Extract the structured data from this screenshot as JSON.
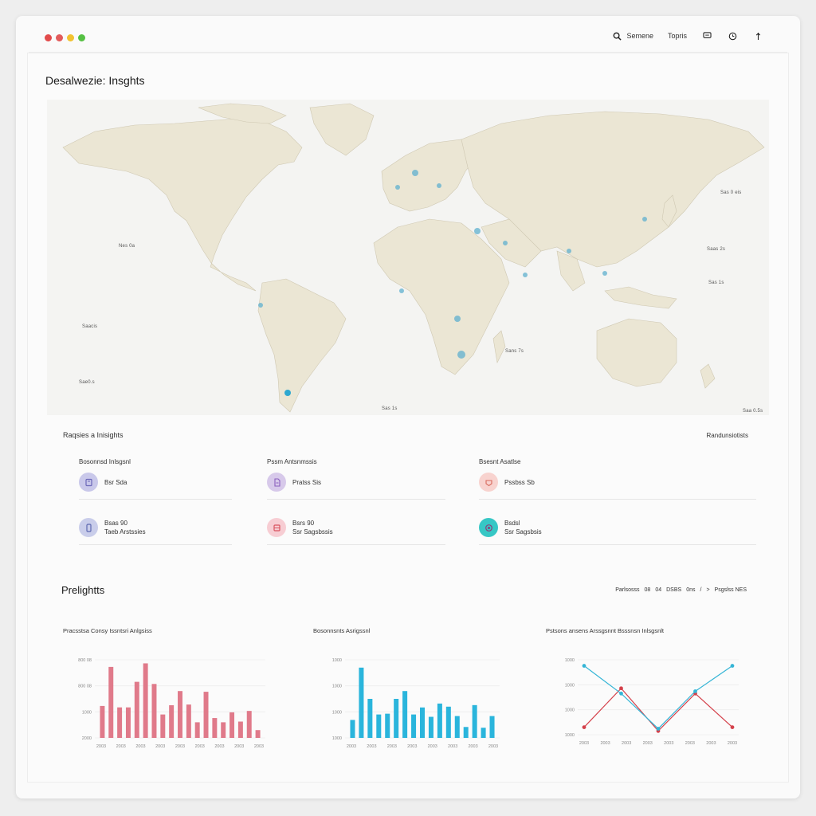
{
  "window": {
    "controls": [
      {
        "name": "close",
        "color": "#e24b4b"
      },
      {
        "name": "minimize",
        "color": "#e25b5b"
      },
      {
        "name": "zoom",
        "color": "#f2c230"
      },
      {
        "name": "extra",
        "color": "#55c043"
      }
    ]
  },
  "toolbar": {
    "search_label": "Semene",
    "topic_label": "Topris",
    "chat_icon": "chat-icon",
    "clock_icon": "clock-icon",
    "menu_icon": "more-icon"
  },
  "page": {
    "title": "Desalwezie: Insghts"
  },
  "map": {
    "labels": [
      "Nes 0a",
      "Saacis",
      "Sae0.s",
      "Sas 0 eis",
      "Saas 2s",
      "Sas 1s",
      "Sans 7s",
      "Sas 1s",
      "Saa 0.5s"
    ],
    "marker_color": "#3fa9c9"
  },
  "regional": {
    "title": "Raqsies a Inisights",
    "right_label": "Randunsiotists",
    "cards": [
      {
        "heading": "Bosonnsd Inlsgsnl",
        "items": [
          {
            "icon": "document-icon",
            "icon_bg": "#c9c8ea",
            "icon_color": "#6b67b8",
            "lines": [
              "Bsr Sda"
            ]
          },
          {
            "icon": "phone-icon",
            "icon_bg": "#c9cdea",
            "icon_color": "#5c67b0",
            "lines": [
              "Bsas 90",
              "Taeb Arstssies"
            ]
          }
        ]
      },
      {
        "heading": "Pssm Antsnmssis",
        "items": [
          {
            "icon": "file-icon",
            "icon_bg": "#d7c9ea",
            "icon_color": "#8a5fbd",
            "lines": [
              "Pratss Sis"
            ]
          },
          {
            "icon": "storage-icon",
            "icon_bg": "#f7cdd3",
            "icon_color": "#d9535f",
            "lines": [
              "Bsrs 90",
              "Ssr Sagsbssis"
            ]
          }
        ]
      },
      {
        "heading": "Bsesnt Asatlse",
        "items": [
          {
            "icon": "tag-icon",
            "icon_bg": "#f8d3cf",
            "icon_color": "#d76a5d",
            "lines": [
              "Pssbss Sb"
            ]
          },
          {
            "icon": "target-icon",
            "icon_bg": "#37c7c5",
            "icon_color": "#8a3f7a",
            "lines": [
              "Bsdsl",
              "Ssr Sagsbsis"
            ]
          }
        ]
      }
    ]
  },
  "predictions": {
    "title": "Prelightts",
    "pager": [
      "Parlsosss",
      "08",
      "04",
      "DSBS",
      "0ns",
      "/",
      ">",
      "Psgslss NES"
    ],
    "charts": [
      {
        "title": "Pracsstsa Consy Issntsri Anlgsiss",
        "color": "#e07a8a",
        "y_ticks": [
          "800 08",
          "800 08",
          "1000",
          "2000"
        ],
        "x_ticks": [
          "2003",
          "2003",
          "2003",
          "2003",
          "2003",
          "2003",
          "2003",
          "2003",
          "2003"
        ]
      },
      {
        "title": "Bosonnsnts Asrigssnl",
        "color": "#2ab5dc",
        "y_ticks": [
          "1000",
          "1000",
          "1000",
          "1000"
        ],
        "x_ticks": [
          "2003",
          "2003",
          "2003",
          "2003",
          "2003",
          "2003",
          "2003",
          "2003"
        ]
      },
      {
        "title": "Pstsons ansens Arssgsnnt Bsssnsn Inlsgsnlt",
        "color_a": "#d4404a",
        "color_b": "#35b5d6",
        "y_ticks": [
          "1000",
          "1000",
          "1000",
          "1000"
        ],
        "x_ticks": [
          "2003",
          "2003",
          "2003",
          "2003",
          "2003",
          "2003",
          "2003",
          "2003"
        ]
      }
    ]
  },
  "chart_data": [
    {
      "type": "bar",
      "title": "Pracsstsa Consy Issntsri Anlgsiss",
      "categories": [
        "2003",
        "2003",
        "2003",
        "2003",
        "2003",
        "2003",
        "2003",
        "2003",
        "2003"
      ],
      "values": [
        45,
        100,
        43,
        43,
        79,
        105,
        76,
        33,
        46,
        66,
        47,
        22,
        65,
        28,
        22,
        36,
        23,
        38,
        11
      ],
      "ylim": [
        0,
        110
      ]
    },
    {
      "type": "bar",
      "title": "Bosonnsnts Asrigssnl",
      "categories": [
        "2003",
        "2003",
        "2003",
        "2003",
        "2003",
        "2003",
        "2003",
        "2003"
      ],
      "values": [
        23,
        90,
        50,
        30,
        31,
        50,
        60,
        30,
        39,
        27,
        44,
        40,
        28,
        14,
        42,
        13,
        28
      ],
      "ylim": [
        0,
        100
      ]
    },
    {
      "type": "line",
      "title": "Pstsons ansens Arssgsnnt Bsssnsn Inlsgsnlt",
      "series": [
        {
          "values": [
            10,
            62,
            5,
            55,
            10
          ]
        },
        {
          "values": [
            92,
            55,
            8,
            58,
            92
          ]
        }
      ],
      "ylim": [
        0,
        100
      ]
    }
  ]
}
